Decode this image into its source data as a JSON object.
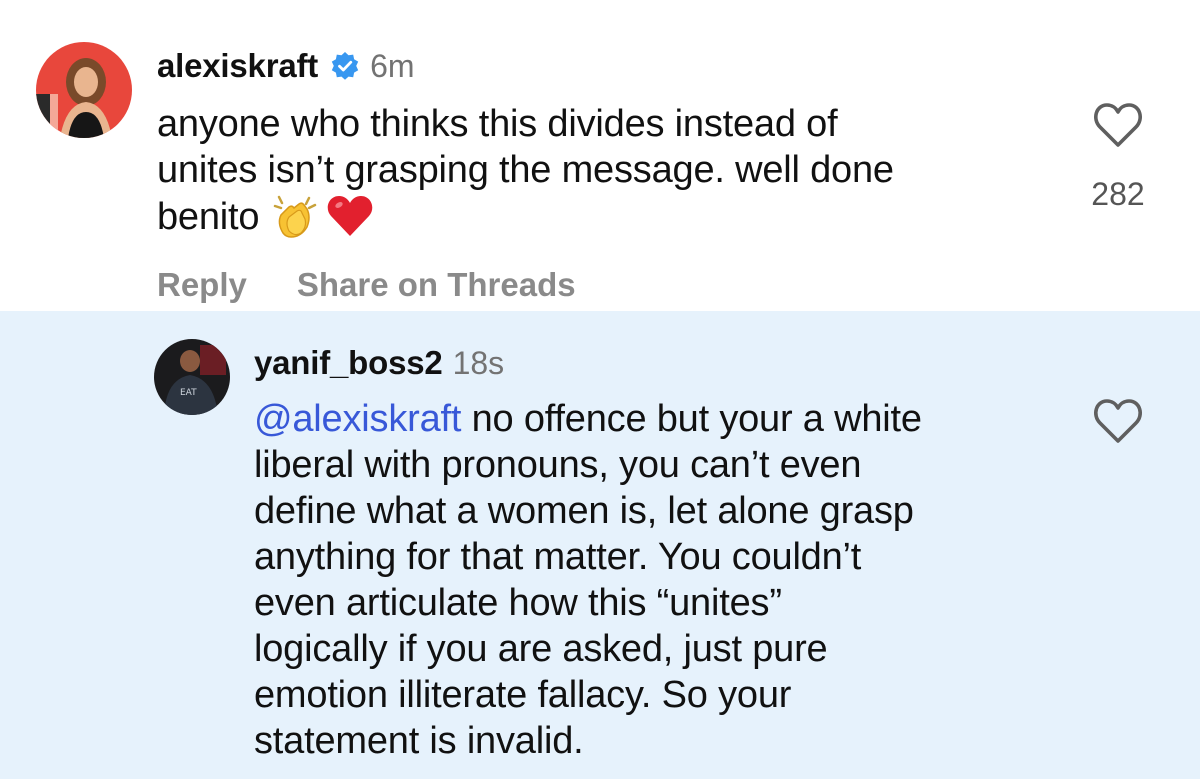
{
  "comment": {
    "username": "alexiskraft",
    "timestamp": "6m",
    "text_lines": [
      "anyone who thinks this divides instead of",
      "unites isn’t grasping the message. well done",
      "benito"
    ],
    "emojis": [
      "clapping-hands",
      "red-heart"
    ],
    "like_count": "282",
    "actions": {
      "reply": "Reply",
      "share": "Share on Threads"
    }
  },
  "reply": {
    "username": "yanif_boss2",
    "timestamp": "18s",
    "mention": "@alexiskraft",
    "text_first_line_rest": " no offence but your a white",
    "text_lines": [
      "liberal with pronouns, you can’t even",
      "define what a women is, let alone grasp",
      "anything for that matter. You couldn’t",
      "even articulate how this “unites”",
      "logically if you are asked, just pure",
      "emotion illiterate fallacy. So your",
      "statement is invalid."
    ],
    "avatar_text": "EAT"
  },
  "colors": {
    "verified": "#3897f0",
    "mention": "#3858d8",
    "reply_background": "#e6f2fc",
    "muted": "#737373"
  },
  "icons": {
    "verified": "verified-badge-icon",
    "like": "heart-outline-icon"
  }
}
